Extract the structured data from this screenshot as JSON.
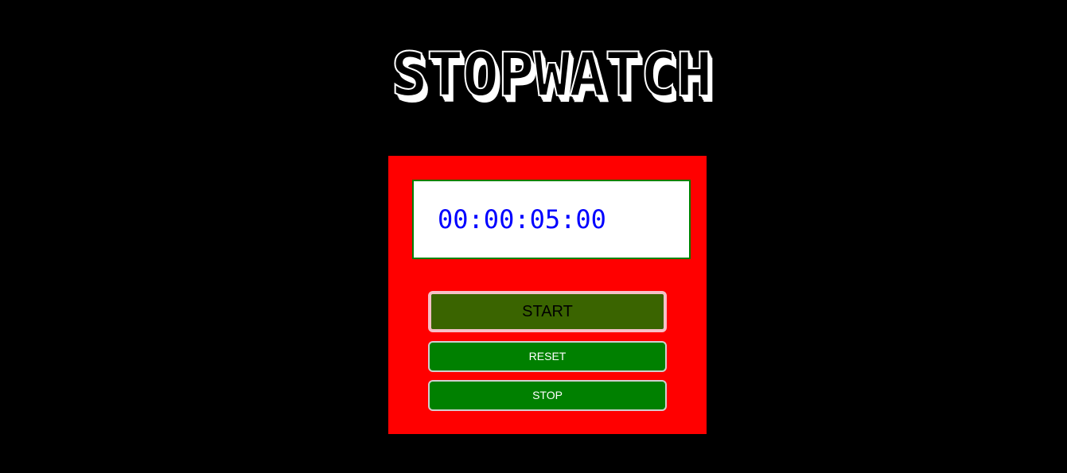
{
  "app": {
    "title": "STOPWATCH"
  },
  "display": {
    "time": "00:00:05:00"
  },
  "buttons": {
    "start_label": "START",
    "reset_label": "RESET",
    "stop_label": "STOP"
  },
  "colors": {
    "background": "#000000",
    "panel": "#ff0000",
    "display_border": "#008000",
    "time_text": "#0000ff",
    "start_button": "#3a6400",
    "start_button_border": "#f6c0c8",
    "secondary_buttons": "#008000"
  }
}
